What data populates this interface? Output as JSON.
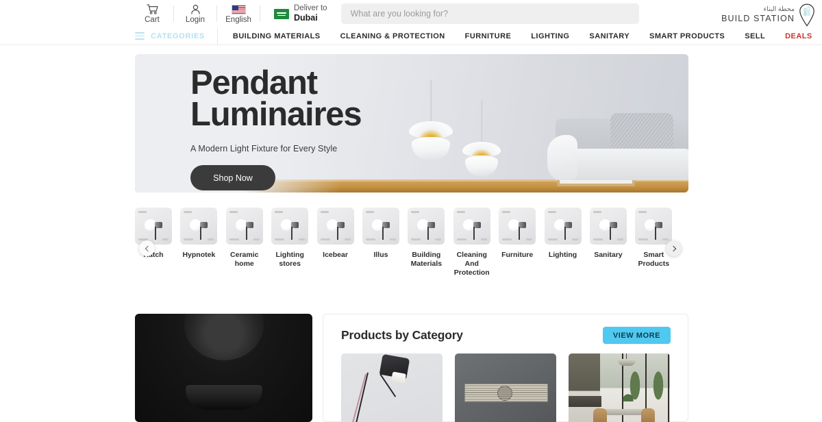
{
  "header": {
    "cart_label": "Cart",
    "login_label": "Login",
    "language_label": "English",
    "deliver_to_label": "Deliver to",
    "deliver_city": "Dubai",
    "search_placeholder": "What are you looking for?",
    "search_value": "",
    "brand_arabic": "محطة البناء",
    "brand_english": "BUILD STATION"
  },
  "nav": {
    "categories_label": "CATEGORIES",
    "links": [
      {
        "label": "BUILDING MATERIALS",
        "highlight": false
      },
      {
        "label": "CLEANING & PROTECTION",
        "highlight": false
      },
      {
        "label": "FURNITURE",
        "highlight": false
      },
      {
        "label": "LIGHTING",
        "highlight": false
      },
      {
        "label": "SANITARY",
        "highlight": false
      },
      {
        "label": "SMART PRODUCTS",
        "highlight": false
      },
      {
        "label": "SELL",
        "highlight": false
      },
      {
        "label": "DEALS",
        "highlight": true
      }
    ],
    "deals_color": "#cf3030",
    "categories_color": "#b2e2f0"
  },
  "hero": {
    "title_line1": "Pendant",
    "title_line2": "Luminaires",
    "subtitle": "A Modern Light Fixture for Every Style",
    "cta_label": "Shop Now"
  },
  "carousel": {
    "prev_icon": "chevron-left-icon",
    "next_icon": "chevron-right-icon",
    "items": [
      {
        "label": "Hatch"
      },
      {
        "label": "Hypnotek"
      },
      {
        "label": "Ceramic home"
      },
      {
        "label": "Lighting stores"
      },
      {
        "label": "Icebear"
      },
      {
        "label": "Illus"
      },
      {
        "label": "Building Materials"
      },
      {
        "label": "Cleaning And Protection"
      },
      {
        "label": "Furniture"
      },
      {
        "label": "Lighting"
      },
      {
        "label": "Sanitary"
      },
      {
        "label": "Smart Products"
      }
    ]
  },
  "products_section": {
    "title": "Products by Category",
    "view_more_label": "VIEW MORE",
    "view_more_color": "#4fc9ef",
    "cards": [
      {
        "name": "floor-lamp"
      },
      {
        "name": "linear-drain"
      },
      {
        "name": "interior-dining"
      }
    ]
  },
  "promo_panel": {
    "name": "black-sanitary-ware-promo"
  }
}
